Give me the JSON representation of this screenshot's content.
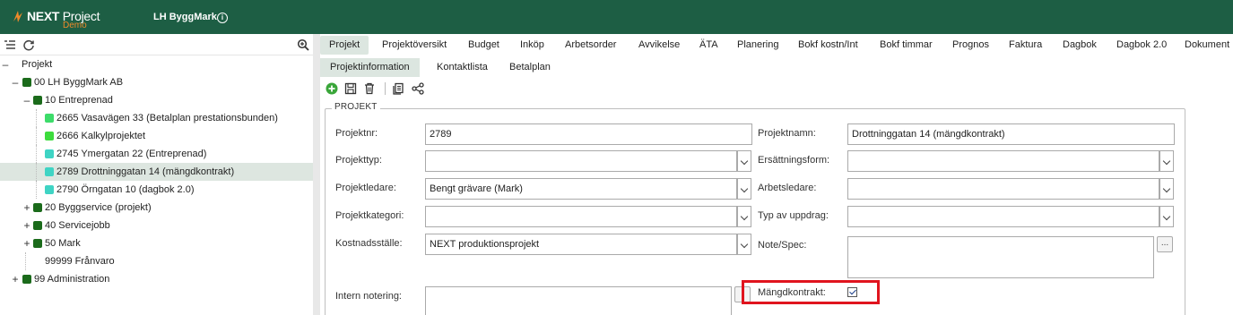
{
  "header": {
    "brand_bold": "NEXT",
    "brand_thin": "Project",
    "brand_sub": "Demo",
    "company": "LH ByggMark",
    "colors": {
      "bar": "#1d5e44",
      "accent": "#f08a2a"
    }
  },
  "tree": {
    "root": "Projekt",
    "nodes": [
      {
        "label": "00 LH ByggMark AB",
        "toggle": "–",
        "color": "#1b6b1b"
      },
      {
        "label": "10 Entreprenad",
        "toggle": "–",
        "color": "#1b6b1b"
      },
      {
        "label": "2665 Vasavägen 33 (Betalplan prestationsbunden)",
        "toggle": "",
        "color": "#3ddc6a"
      },
      {
        "label": "2666 Kalkylprojektet",
        "toggle": "",
        "color": "#3ddc3d"
      },
      {
        "label": "2745 Ymergatan 22 (Entreprenad)",
        "toggle": "",
        "color": "#3fd4c4"
      },
      {
        "label": "2789 Drottninggatan 14 (mängdkontrakt)",
        "toggle": "",
        "color": "#3fd4c4"
      },
      {
        "label": "2790 Örngatan 10 (dagbok 2.0)",
        "toggle": "",
        "color": "#3fd4c4"
      },
      {
        "label": "20 Byggservice (projekt)",
        "toggle": "+",
        "color": "#1b6b1b"
      },
      {
        "label": "40 Servicejobb",
        "toggle": "+",
        "color": "#1b6b1b"
      },
      {
        "label": "50 Mark",
        "toggle": "+",
        "color": "#1b6b1b"
      },
      {
        "label": "99999 Frånvaro",
        "toggle": "",
        "color": "#ffffff"
      },
      {
        "label": "99 Administration",
        "toggle": "+",
        "color": "#1b6b1b"
      }
    ]
  },
  "tabs": [
    "Projekt",
    "Projektöversikt",
    "Budget",
    "Inköp",
    "Arbetsorder",
    "Avvikelse",
    "ÄTA",
    "Planering",
    "Bokf kostn/Int",
    "Bokf timmar",
    "Prognos",
    "Faktura",
    "Dagbok",
    "Dagbok 2.0",
    "Dokument"
  ],
  "subtabs": [
    "Projektinformation",
    "Kontaktlista",
    "Betalplan"
  ],
  "form": {
    "legend": "PROJEKT",
    "projektnr_label": "Projektnr:",
    "projektnr_value": "2789",
    "projektnamn_label": "Projektnamn:",
    "projektnamn_value": "Drottninggatan 14 (mängdkontrakt)",
    "projekttyp_label": "Projekttyp:",
    "projekttyp_value": "",
    "ersattningsform_label": "Ersättningsform:",
    "ersattningsform_value": "",
    "projektledare_label": "Projektledare:",
    "projektledare_value": "Bengt grävare (Mark)",
    "arbetsledare_label": "Arbetsledare:",
    "arbetsledare_value": "",
    "projektkategori_label": "Projektkategori:",
    "projektkategori_value": "",
    "typ_av_uppdrag_label": "Typ av uppdrag:",
    "typ_av_uppdrag_value": "",
    "kostnadsstalle_label": "Kostnadsställe:",
    "kostnadsstalle_value": "NEXT produktionsprojekt",
    "note_spec_label": "Note/Spec:",
    "dots_label": "...",
    "intern_notering_label": "Intern notering:",
    "mangdkontrakt_label": "Mängdkontrakt:",
    "mangdkontrakt_checked": true
  }
}
